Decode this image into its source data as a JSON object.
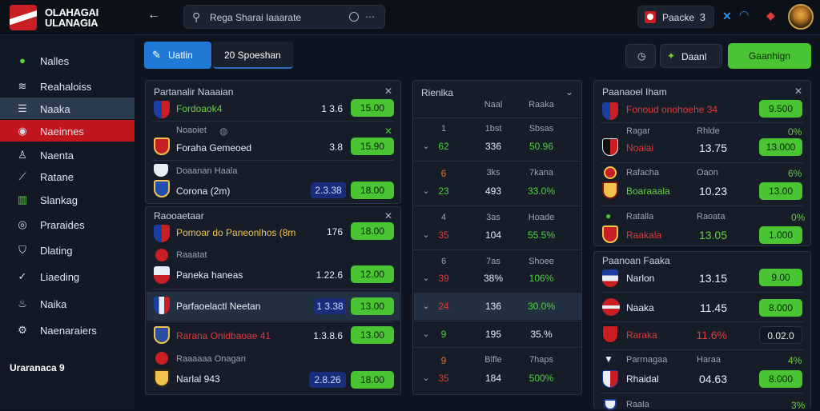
{
  "app": {
    "brand_line1": "OLAHAGAI",
    "brand_line2": "ULANAGIA"
  },
  "topbar": {
    "back_label": "←",
    "search_text": "Rega Sharai Iaaarate",
    "search_more": "⋯",
    "account_name": "Paacke",
    "account_num": "3"
  },
  "sidebar": {
    "items": [
      {
        "label": "Nalles",
        "icon": "soccer-ball-icon"
      },
      {
        "label": "Reahaloiss",
        "icon": "wifi-icon"
      },
      {
        "label": "Naaka",
        "icon": "list-icon"
      },
      {
        "label": "Naeinnes",
        "icon": "target-icon"
      },
      {
        "label": "Naenta",
        "icon": "user-icon"
      },
      {
        "label": "Ratane",
        "icon": "chart-icon"
      },
      {
        "label": "Slankag",
        "icon": "bars-icon"
      },
      {
        "label": "Praraides",
        "icon": "globe-icon"
      },
      {
        "label": "Dlating",
        "icon": "shield-icon"
      },
      {
        "label": "Liaeding",
        "icon": "check-icon"
      },
      {
        "label": "Naika",
        "icon": "flame-icon"
      },
      {
        "label": "Naenaraiers",
        "icon": "settings-icon"
      }
    ],
    "footer": "Uraranaca 9"
  },
  "tabs": {
    "tab1": "Uatlin",
    "tab2": "20 Spoeshan"
  },
  "actions": {
    "btn2": "Daanl",
    "btn3": "Gaanhign"
  },
  "left_panel1": {
    "header": "Partanalir Naaaian",
    "rows": [
      {
        "team": "Fordoaok4",
        "odd": "1 3.6",
        "pill": "15.00"
      },
      {
        "sub": "Noaoiet",
        "team": "Foraha  Gemeoed",
        "odd": "3.8",
        "pill": "15.90"
      },
      {
        "sub": "Doaanan Haala",
        "team": "Corona (2m)",
        "odd": "2.3.38",
        "pill": "18.00"
      }
    ]
  },
  "left_panel2": {
    "header": "Raooaetaar",
    "rows": [
      {
        "team": "Pomoar do Paneonlhos (8m",
        "odd": "176",
        "pill": "18.00"
      },
      {
        "sub": "Raaatat",
        "team": "Paneka    haneas",
        "odd": "1.22.6",
        "pill": "12.00"
      },
      {
        "team": "Parfaoelactl Neetan",
        "odd": "1 3.38",
        "pill": "13.00"
      },
      {
        "team": "Rarana Onidbaoae 41",
        "odd": "1.3.8.6",
        "pill": "13.00"
      },
      {
        "sub": "Raaaaaa Onagan",
        "team": "Narlal 943",
        "odd": "2.8.26",
        "pill": "18.00"
      }
    ]
  },
  "mid_panel": {
    "header": "Rienlka",
    "col1": "Naal",
    "col2": "Raaka",
    "rows": [
      {
        "a": "1",
        "b": "1bst",
        "c": "Sbsas",
        "d": "62",
        "e": "336",
        "f": "50.96"
      },
      {
        "a": "6",
        "b": "3ks",
        "c": "7kana",
        "d": "23",
        "e": "493",
        "f": "33.0%"
      },
      {
        "a": "4",
        "b": "3as",
        "c": "Hoade",
        "d": "35",
        "e": "104",
        "f": "55.5%"
      },
      {
        "a": "6",
        "b": "7as",
        "c": "Shoee",
        "d": "39",
        "e": "38%",
        "f": "106%"
      },
      {
        "a": "",
        "b": "",
        "c": "",
        "d": "24",
        "e": "136",
        "f": "30.0%"
      },
      {
        "a": "",
        "b": "",
        "c": "",
        "d": "9",
        "e": "195",
        "f": "35.%"
      },
      {
        "a": "9",
        "b": "Blfle",
        "c": "7haps",
        "d": "35",
        "e": "184",
        "f": "500%"
      }
    ]
  },
  "right_panel1": {
    "header": "Paanaoel Iham",
    "rows": [
      {
        "team": "Fonoud onohoehe 34",
        "pill": "9.500"
      },
      {
        "sub": "Ragar",
        "sub2": "Rhlde",
        "pct": "0%",
        "team": "Noaiai",
        "odd": "13.75",
        "pill": "13.000"
      },
      {
        "sub": "Rafacha",
        "sub2": "Oaon",
        "pct": "6%",
        "team": "Boaraaala",
        "odd": "10.23",
        "pill": "13.00"
      },
      {
        "sub": "Ratalla",
        "sub2": "Raoata",
        "pct": "0%",
        "team": "Raakala",
        "odd": "13.05",
        "pill": "1.000"
      }
    ]
  },
  "right_panel2": {
    "header": "Paanoan Faaka",
    "rows": [
      {
        "team": "Narlon",
        "odd": "13.15",
        "pill": "9.00"
      },
      {
        "team": "Naaka",
        "odd": "11.45",
        "pill": "8.000"
      },
      {
        "team": "Raraka",
        "odd": "11.6%",
        "pill": "0.02.0"
      },
      {
        "sub": "Parrnagaa",
        "sub2": "Haraa",
        "pct": "4%",
        "team": "Rhaidal",
        "odd": "04.63",
        "pill": "8.000"
      },
      {
        "sub": "Raala",
        "pct": "3%"
      }
    ]
  },
  "colors": {
    "accent_green": "#49c433",
    "accent_blue": "#1f7ad6",
    "accent_red": "#c1161d"
  }
}
